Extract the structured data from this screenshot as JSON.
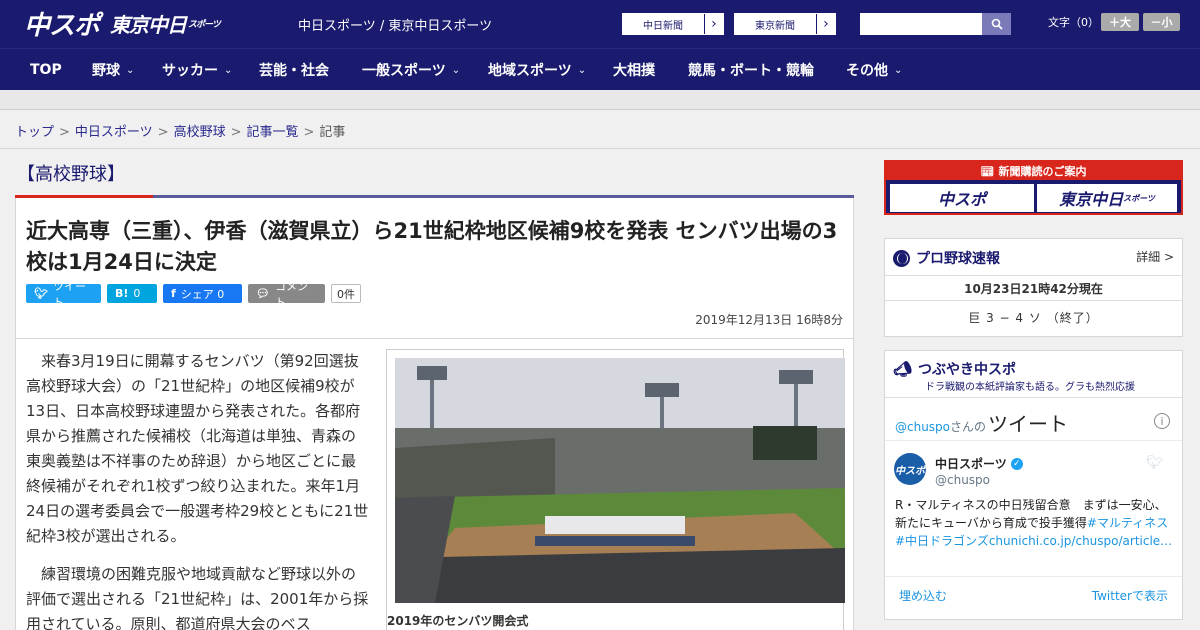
{
  "header": {
    "logo_main": "中スポ",
    "logo_tokyo": "東京中日",
    "logo_tokyo_small": "スポーツ",
    "site_title": "中日スポーツ / 東京中日スポーツ",
    "ext_links": [
      {
        "label": "中日新聞"
      },
      {
        "label": "東京新聞"
      }
    ],
    "search_placeholder": "",
    "font_size_label": "文字（0）",
    "font_plus": "＋大",
    "font_minus": "－小"
  },
  "nav": {
    "items": [
      {
        "label": "TOP",
        "chev": ""
      },
      {
        "label": "野球",
        "chev": "⌄"
      },
      {
        "label": "サッカー",
        "chev": "⌄"
      },
      {
        "label": "芸能・社会",
        "chev": ""
      },
      {
        "label": "一般スポーツ",
        "chev": "⌄"
      },
      {
        "label": "地域スポーツ",
        "chev": "⌄"
      },
      {
        "label": "大相撲",
        "chev": ""
      },
      {
        "label": "競馬・ボート・競輪",
        "chev": ""
      },
      {
        "label": "その他",
        "chev": "⌄"
      }
    ]
  },
  "breadcrumb": {
    "items": [
      "トップ",
      "中日スポーツ",
      "高校野球",
      "記事一覧"
    ],
    "current": "記事",
    "sep": ">"
  },
  "article": {
    "category": "【高校野球】",
    "title": "近大高専（三重）、伊香（滋賀県立）ら21世紀枠地区候補9校を発表 センバツ出場の3校は1月24日に決定",
    "share": {
      "tweet": "ツイート",
      "hatena_icon": "B!",
      "hatena_count": "0",
      "facebook": "シェア 0",
      "comment": "コメント",
      "comment_count": "0件"
    },
    "date": "2019年12月13日 16時8分",
    "paragraphs": [
      "来春3月19日に開幕するセンバツ（第92回選抜高校野球大会）の「21世紀枠」の地区候補9校が13日、日本高校野球連盟から発表された。各都府県から推薦された候補校（北海道は単独、青森の東奥義塾は不祥事のため辞退）から地区ごとに最終候補がそれぞれ1校ずつ絞り込まれた。来年1月24日の選考委員会で一般選考枠29校とともに21世紀枠3校が選出される。",
      "練習環境の困難克服や地域貢献など野球以外の評価で選出される「21世紀枠」は、2001年から採用されている。原則、都道府県大会のベス"
    ],
    "photo_caption": "2019年のセンバツ開会式"
  },
  "sidebar": {
    "ad": {
      "head": "新聞購読のご案内",
      "logo1": "中スポ",
      "logo2": "東京中日",
      "logo2_small": "スポーツ"
    },
    "score": {
      "title": "プロ野球速報",
      "detail": "詳細 >",
      "time": "10月23日21時42分現在",
      "line": "巨 3 − 4 ソ （終了）"
    },
    "twitter": {
      "title": "つぶやき中スポ",
      "subtitle": "ドラ戦観の本紙評論家も語る。グラも熱烈応援",
      "handle_link": "@chuspo",
      "handle_suffix": "さんの",
      "header_word": "ツイート",
      "avatar_text": "中スポ",
      "name": "中日スポーツ",
      "handle": "@chuspo",
      "text_plain": "R・マルティネスの中日残留合意　まずは一安心、新たにキューバから育成で投手獲得",
      "text_tag1": "#マルティネス",
      "text_tag2": "#中日ドラゴンズ",
      "text_link": "chunichi.co.jp/chuspo/article…",
      "embed": "埋め込む",
      "view": "Twitterで表示"
    }
  },
  "colors": {
    "brand_navy": "#1a1a6e",
    "accent_red": "#d9261c",
    "twitter_blue": "#1b95e0",
    "hatena": "#00a4de",
    "facebook": "#1877f2",
    "comment_gray": "#888888"
  },
  "icons": {
    "search": "search-icon",
    "chevron": "chevron-right-icon",
    "baseball": "baseball-icon",
    "megaphone": "megaphone-icon",
    "info": "info-icon",
    "twitter": "twitter-bird-icon",
    "verified": "verified-badge-icon"
  }
}
